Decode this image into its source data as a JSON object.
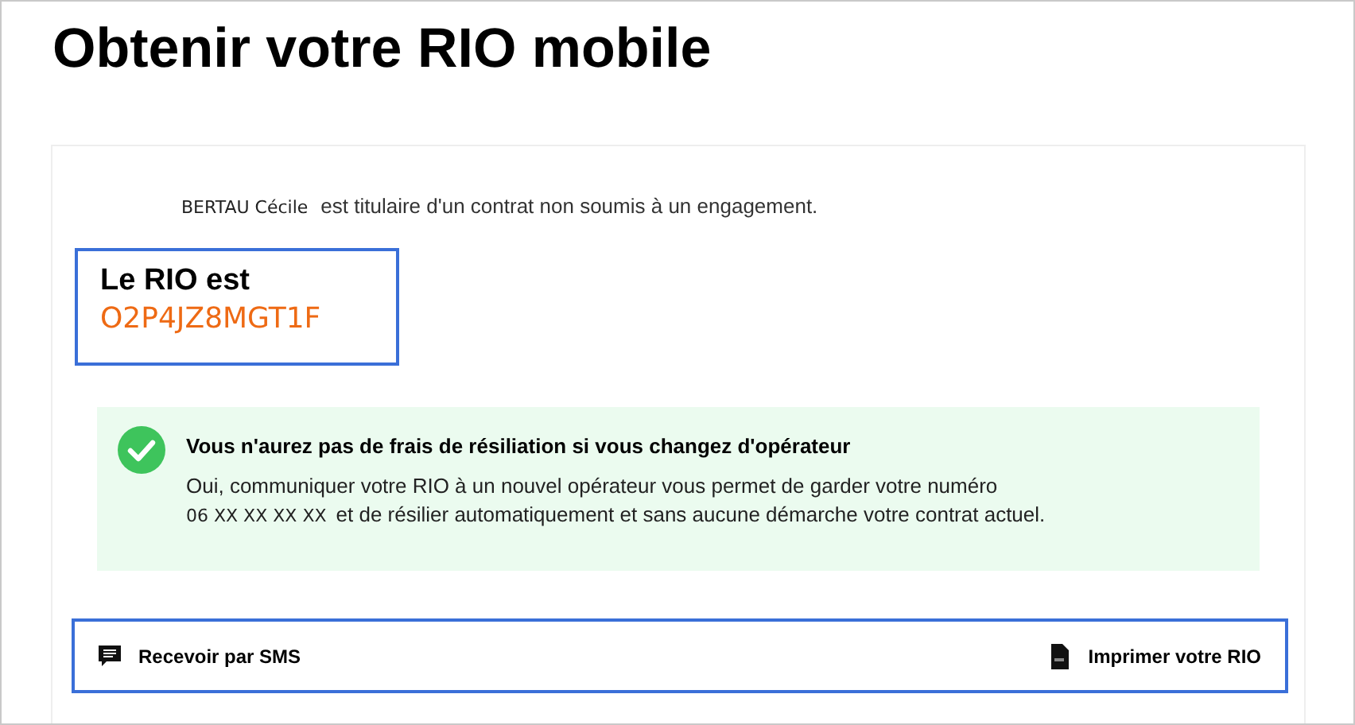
{
  "title": "Obtenir votre RIO mobile",
  "holder": {
    "name": "BERTAU Cécile",
    "statement": "est titulaire d'un contrat non soumis à un engagement."
  },
  "rio": {
    "label": "Le RIO est",
    "code": "O2P4JZ8MGT1F"
  },
  "notice": {
    "kind": "success",
    "title": "Vous n'aurez pas de frais de résiliation si vous changez d'opérateur",
    "line_1": "Oui, communiquer votre RIO à un nouvel opérateur vous permet de garder votre numéro",
    "number": "06 XX XX XX XX",
    "line_2": "et de résilier automatiquement et sans aucune démarche votre contrat actuel."
  },
  "actions": [
    {
      "kind": "sms",
      "label": "Recevoir par SMS"
    },
    {
      "kind": "pdf",
      "label": "Imprimer votre RIO"
    }
  ]
}
